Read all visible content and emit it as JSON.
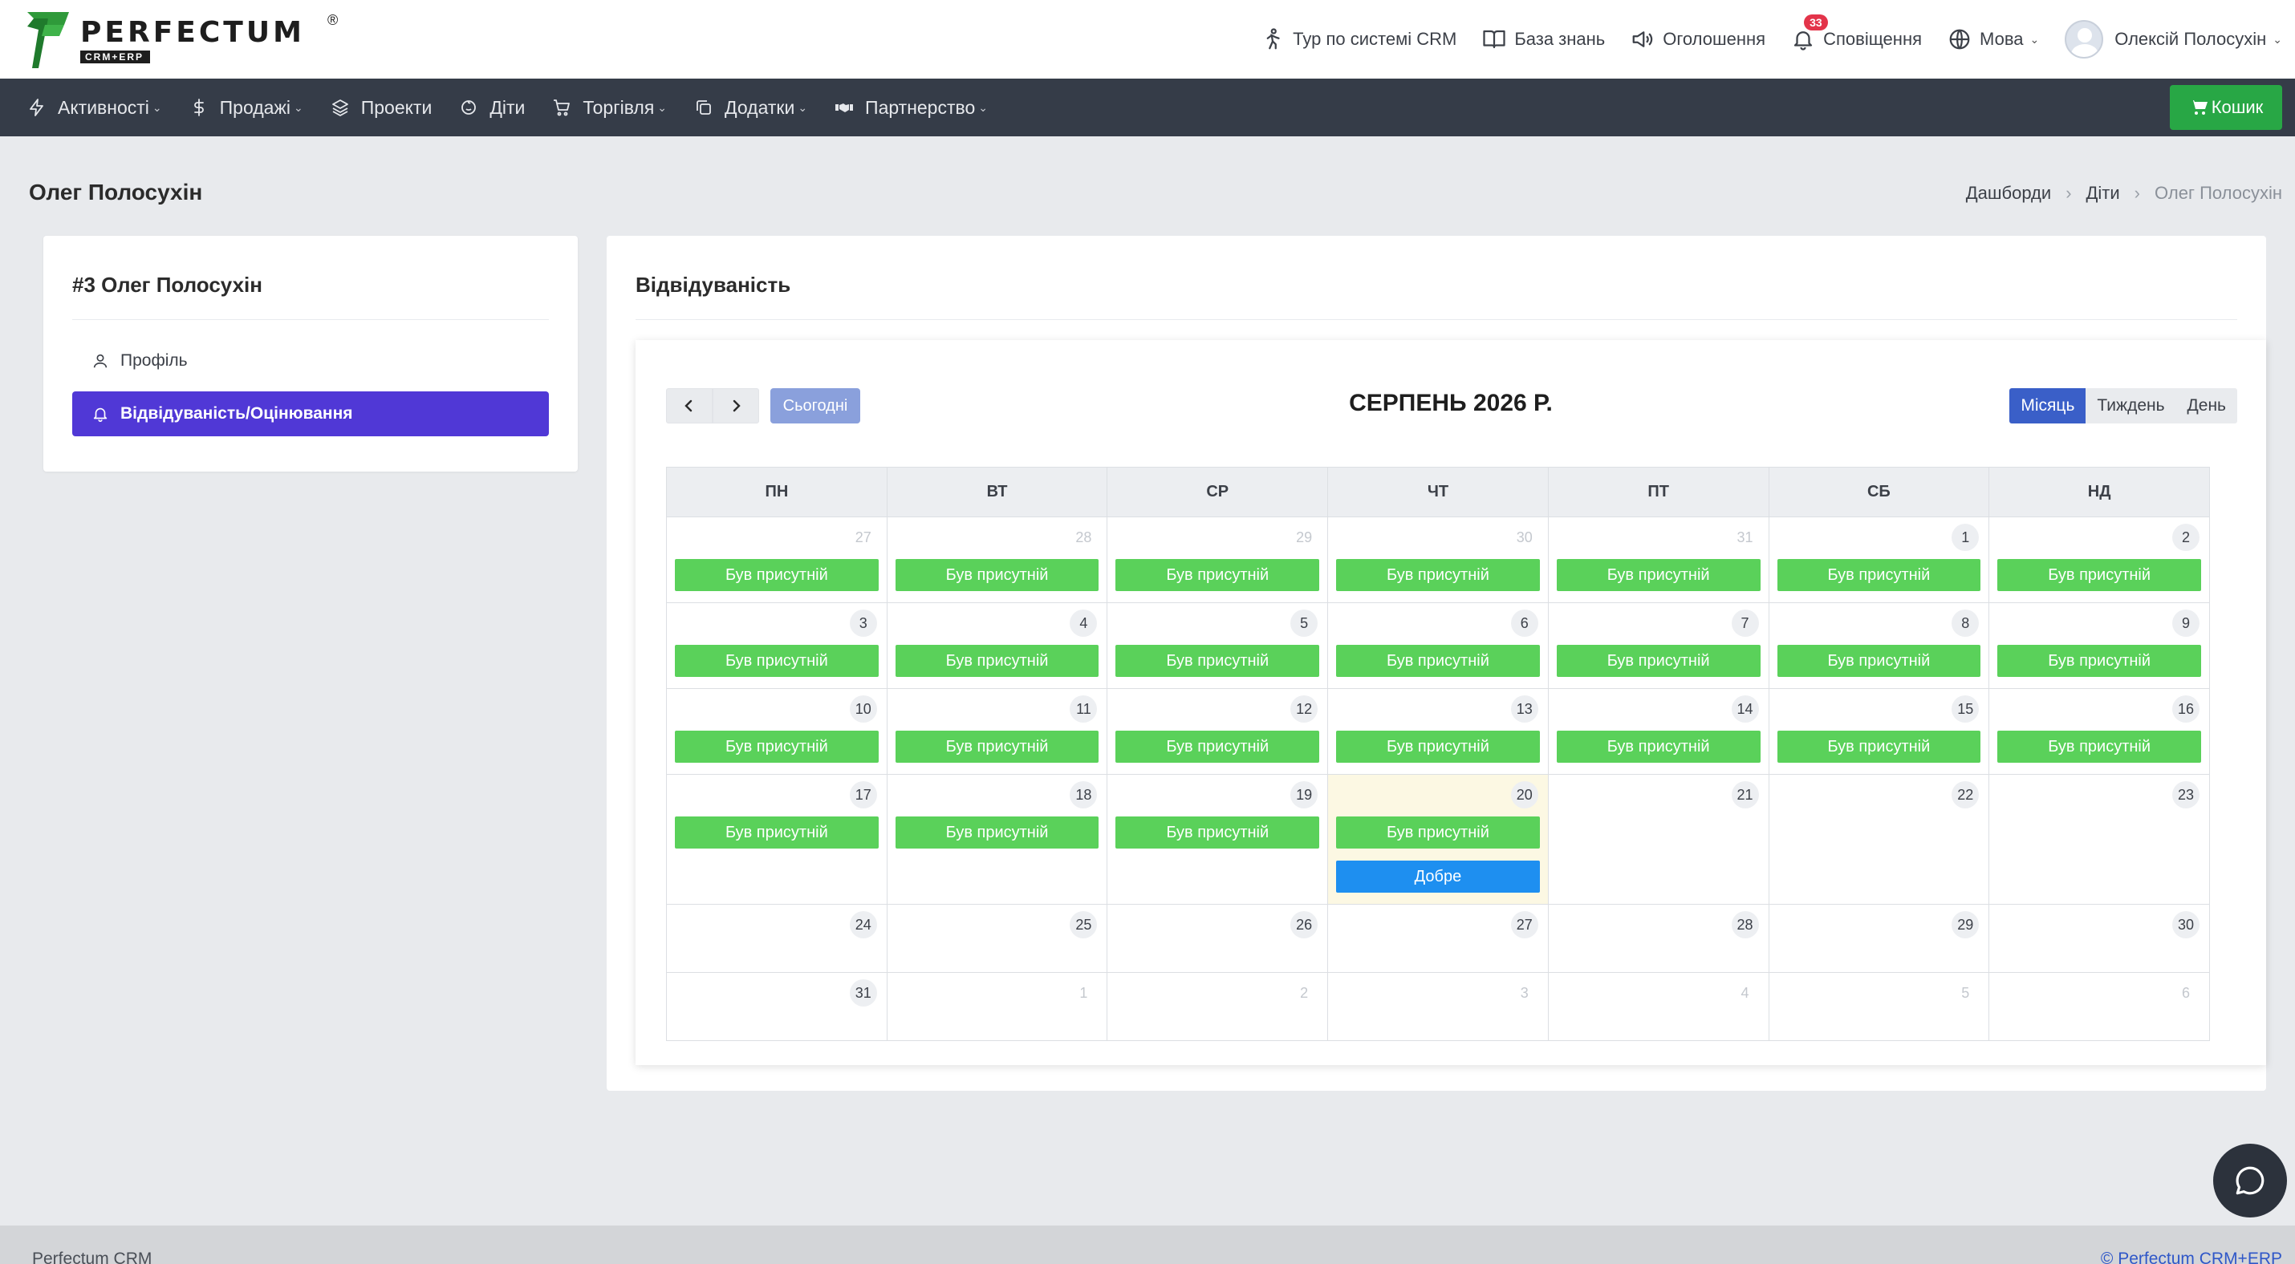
{
  "brand": {
    "name": "PERFECTUM",
    "sub": "CRM+ERP",
    "reg": "®"
  },
  "topnav": {
    "tour": "Тур по системі CRM",
    "knowledge": "База знань",
    "announcements": "Оголошення",
    "notifications": "Сповіщення",
    "notifications_count": "33",
    "language": "Мова",
    "user": "Олексій Полосухін"
  },
  "menu": {
    "items": [
      {
        "label": "Активності",
        "dropdown": true
      },
      {
        "label": "Продажі",
        "dropdown": true
      },
      {
        "label": "Проекти",
        "dropdown": false
      },
      {
        "label": "Діти",
        "dropdown": false
      },
      {
        "label": "Торгівля",
        "dropdown": true
      },
      {
        "label": "Додатки",
        "dropdown": true
      },
      {
        "label": "Партнерство",
        "dropdown": true
      }
    ],
    "cart": "Кошик"
  },
  "page": {
    "title": "Олег Полосухін",
    "breadcrumb": [
      "Дашборди",
      "Діти",
      "Олег Полосухін"
    ]
  },
  "left_card": {
    "title": "#3 Олег Полосухін",
    "links": [
      {
        "label": "Профіль"
      },
      {
        "label": "Відвідуваність/Оцінювання"
      }
    ]
  },
  "attendance": {
    "title": "Відвідуваність",
    "today_btn": "Сьогодні",
    "calendar_title": "СЕРПЕНЬ 2026 Р.",
    "views": [
      "Місяць",
      "Тиждень",
      "День"
    ],
    "active_view": "Місяць",
    "weekdays": [
      "ПН",
      "ВТ",
      "СР",
      "ЧТ",
      "ПТ",
      "СБ",
      "НД"
    ],
    "event_labels": {
      "present": "Був присутній",
      "good": "Добре"
    },
    "weeks": [
      [
        {
          "day": "27",
          "other": true,
          "events": [
            "present"
          ]
        },
        {
          "day": "28",
          "other": true,
          "events": [
            "present"
          ]
        },
        {
          "day": "29",
          "other": true,
          "events": [
            "present"
          ]
        },
        {
          "day": "30",
          "other": true,
          "events": [
            "present"
          ]
        },
        {
          "day": "31",
          "other": true,
          "events": [
            "present"
          ]
        },
        {
          "day": "1",
          "other": false,
          "events": [
            "present"
          ]
        },
        {
          "day": "2",
          "other": false,
          "events": [
            "present"
          ]
        }
      ],
      [
        {
          "day": "3",
          "other": false,
          "events": [
            "present"
          ]
        },
        {
          "day": "4",
          "other": false,
          "events": [
            "present"
          ]
        },
        {
          "day": "5",
          "other": false,
          "events": [
            "present"
          ]
        },
        {
          "day": "6",
          "other": false,
          "events": [
            "present"
          ]
        },
        {
          "day": "7",
          "other": false,
          "events": [
            "present"
          ]
        },
        {
          "day": "8",
          "other": false,
          "events": [
            "present"
          ]
        },
        {
          "day": "9",
          "other": false,
          "events": [
            "present"
          ]
        }
      ],
      [
        {
          "day": "10",
          "other": false,
          "events": [
            "present"
          ]
        },
        {
          "day": "11",
          "other": false,
          "events": [
            "present"
          ]
        },
        {
          "day": "12",
          "other": false,
          "events": [
            "present"
          ]
        },
        {
          "day": "13",
          "other": false,
          "events": [
            "present"
          ]
        },
        {
          "day": "14",
          "other": false,
          "events": [
            "present"
          ]
        },
        {
          "day": "15",
          "other": false,
          "events": [
            "present"
          ]
        },
        {
          "day": "16",
          "other": false,
          "events": [
            "present"
          ]
        }
      ],
      [
        {
          "day": "17",
          "other": false,
          "events": [
            "present"
          ]
        },
        {
          "day": "18",
          "other": false,
          "events": [
            "present"
          ]
        },
        {
          "day": "19",
          "other": false,
          "events": [
            "present"
          ]
        },
        {
          "day": "20",
          "other": false,
          "today": true,
          "events": [
            "present",
            "good"
          ]
        },
        {
          "day": "21",
          "other": false,
          "events": []
        },
        {
          "day": "22",
          "other": false,
          "events": []
        },
        {
          "day": "23",
          "other": false,
          "events": []
        }
      ],
      [
        {
          "day": "24",
          "other": false,
          "events": []
        },
        {
          "day": "25",
          "other": false,
          "events": []
        },
        {
          "day": "26",
          "other": false,
          "events": []
        },
        {
          "day": "27",
          "other": false,
          "events": []
        },
        {
          "day": "28",
          "other": false,
          "events": []
        },
        {
          "day": "29",
          "other": false,
          "events": []
        },
        {
          "day": "30",
          "other": false,
          "events": []
        }
      ],
      [
        {
          "day": "31",
          "other": false,
          "events": []
        },
        {
          "day": "1",
          "other": true,
          "events": []
        },
        {
          "day": "2",
          "other": true,
          "events": []
        },
        {
          "day": "3",
          "other": true,
          "events": []
        },
        {
          "day": "4",
          "other": true,
          "events": []
        },
        {
          "day": "5",
          "other": true,
          "events": []
        },
        {
          "day": "6",
          "other": true,
          "events": []
        }
      ]
    ]
  },
  "footer": {
    "left": "Perfectum CRM",
    "right": "© Perfectum CRM+ERP"
  },
  "colors": {
    "accent": "#5038d6",
    "present": "#5ad15a",
    "good": "#1e8ff0",
    "today_bg": "#fcf8e3",
    "menu_bg": "#353c48",
    "cart": "#28a745"
  }
}
